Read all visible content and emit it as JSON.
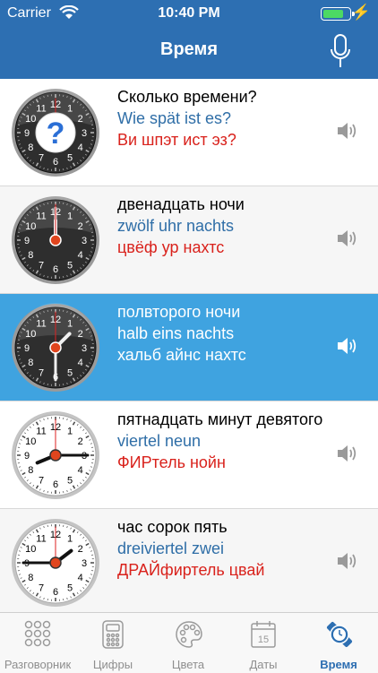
{
  "status": {
    "carrier": "Carrier",
    "time": "10:40 PM"
  },
  "header": {
    "title": "Время"
  },
  "colors": {
    "header": "#2d6fb2",
    "selected": "#3fa3e0",
    "transliteration": "#d9221c",
    "german": "#2f6ea7"
  },
  "rows": [
    {
      "ru": "Сколько времени?",
      "de": "Wie spät ist es?",
      "tr": "Ви шпэт ист эз?",
      "clock": "question"
    },
    {
      "ru": "двенадцать ночи",
      "de": "zwölf uhr nachts",
      "tr": "цвёф ур нахтс",
      "clock": "12:00"
    },
    {
      "ru": "полвторого ночи",
      "de": "halb eins nachts",
      "tr": "хальб айнс нахтс",
      "clock": "1:30"
    },
    {
      "ru": "пятнадцать минут девятого",
      "de": "viertel neun",
      "tr": "ФИРтель нойн",
      "clock": "8:15"
    },
    {
      "ru": "час сорок пять",
      "de": "dreiviertel zwei",
      "tr": "ДРАЙфиртель цвай",
      "clock": "1:45"
    }
  ],
  "clock_numbers": [
    "12",
    "1",
    "2",
    "3",
    "4",
    "5",
    "6",
    "7",
    "8",
    "9",
    "10",
    "11"
  ],
  "tabs": [
    {
      "label": "Разговорник",
      "icon": "dots-grid-icon",
      "active": false
    },
    {
      "label": "Цифры",
      "icon": "calculator-icon",
      "active": false
    },
    {
      "label": "Цвета",
      "icon": "palette-icon",
      "active": false
    },
    {
      "label": "Даты",
      "icon": "calendar-icon",
      "active": false,
      "icon_text": "15"
    },
    {
      "label": "Время",
      "icon": "watch-icon",
      "active": true
    }
  ]
}
